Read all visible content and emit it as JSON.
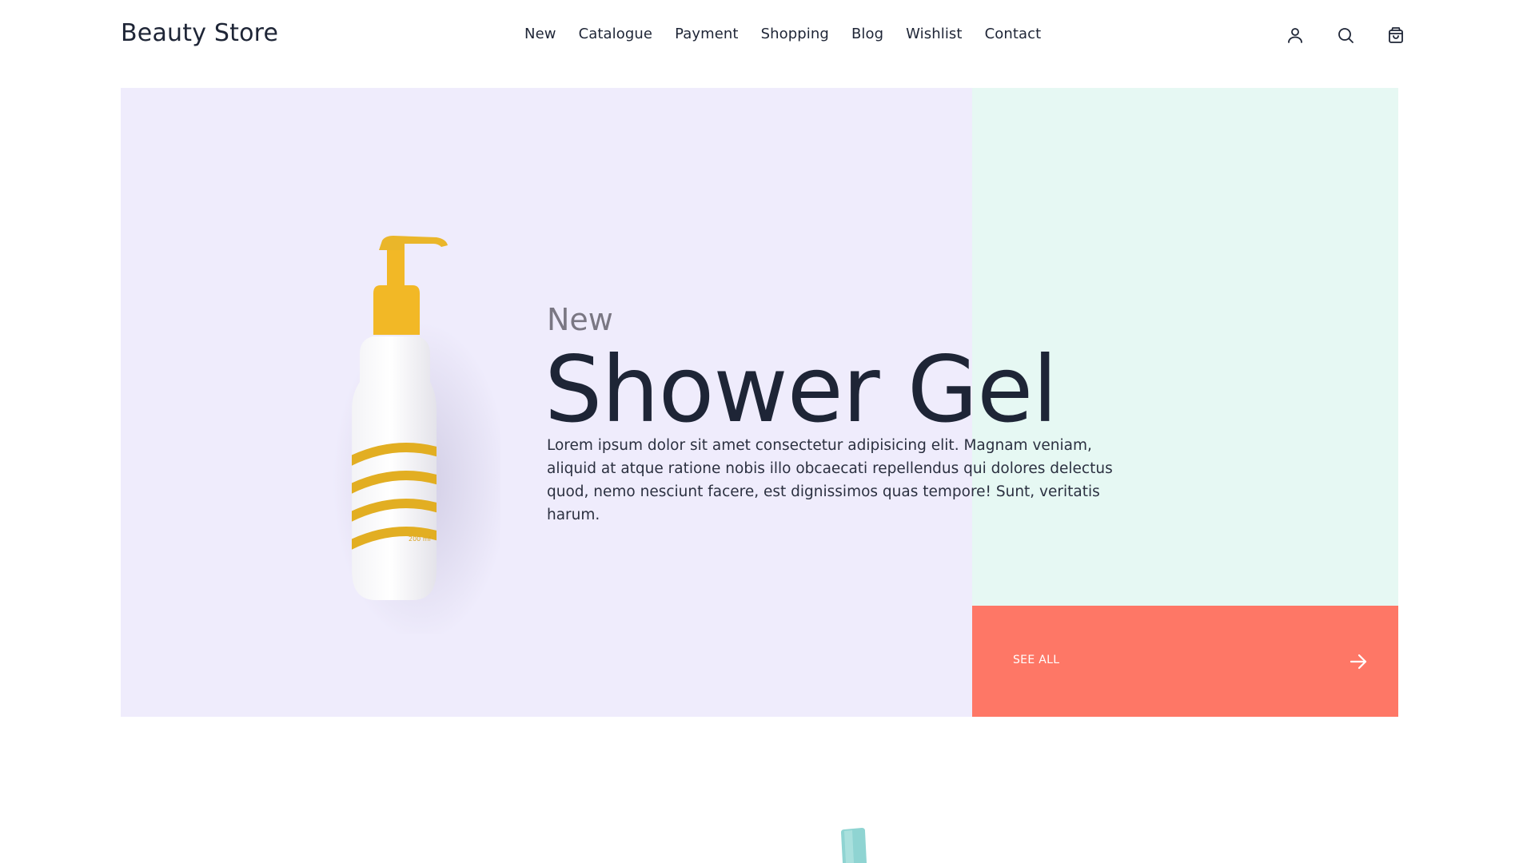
{
  "header": {
    "logo": "Beauty Store",
    "nav": [
      "New",
      "Catalogue",
      "Payment",
      "Shopping",
      "Blog",
      "Wishlist",
      "Contact"
    ],
    "icons": [
      "user-icon",
      "search-icon",
      "shopping-bag-icon"
    ]
  },
  "hero": {
    "eyebrow": "New",
    "title": "Shower Gel",
    "description": "Lorem ipsum dolor sit amet consectetur adipisicing elit. Magnam veniam, aliquid at atque ratione nobis illo obcaecati repellendus qui dolores delectus quod, nemo nesciunt facere, est dignissimos quas tempore! Sunt, veritatis harum.",
    "bottle_label": "200 ml",
    "cta_label": "SEE ALL",
    "cta_icon": "arrow-right-icon"
  },
  "colors": {
    "hero_bg": "#efecfc",
    "mint_panel": "#e6f8f3",
    "cta": "#fe7766",
    "text_dark": "#1e2536",
    "accent_yellow": "#f2b826"
  }
}
